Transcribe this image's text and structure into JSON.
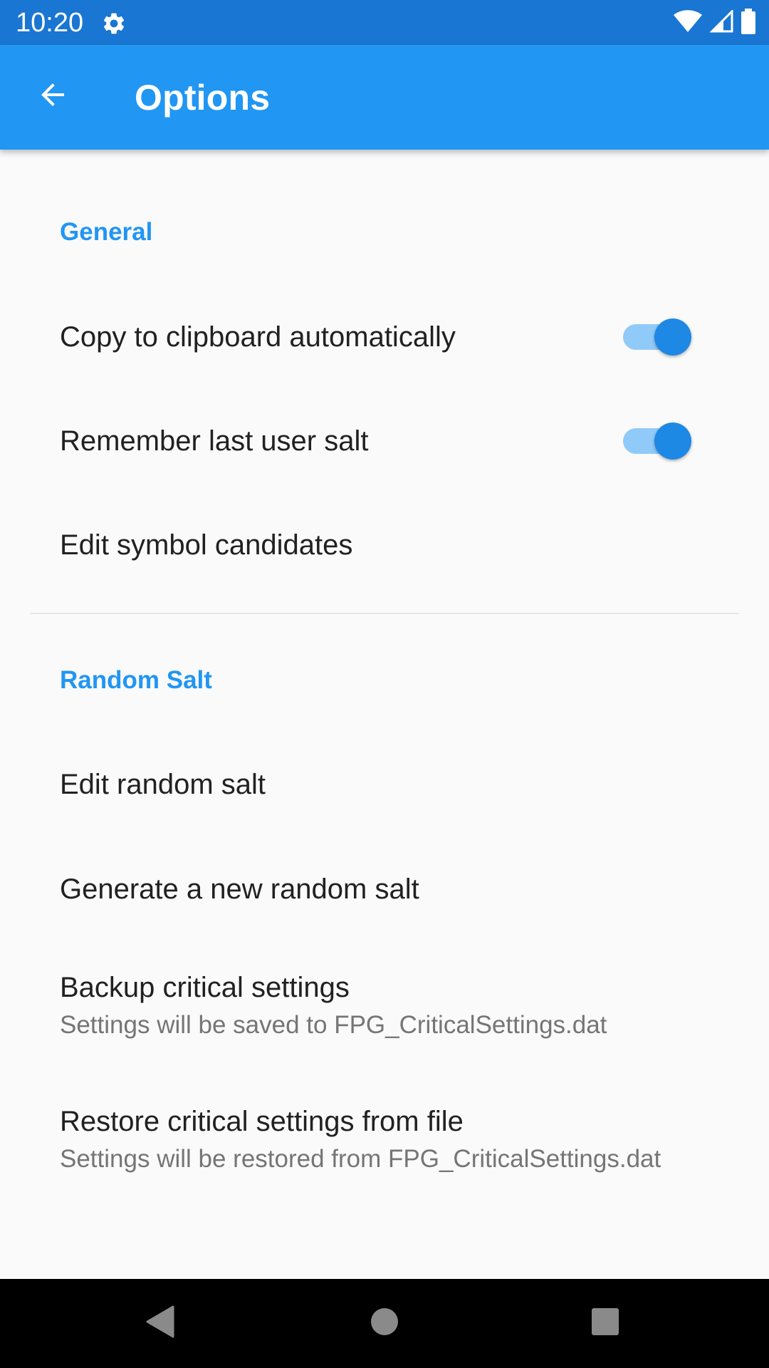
{
  "status_bar": {
    "time": "10:20",
    "icons": [
      "gear-icon",
      "wifi-icon",
      "signal-icon",
      "battery-icon"
    ]
  },
  "app_bar": {
    "title": "Options",
    "back_icon": "arrow-back-icon"
  },
  "sections": {
    "general": {
      "header": "General",
      "items": {
        "copy_clipboard": {
          "title": "Copy to clipboard automatically",
          "switch_on": true
        },
        "remember_salt": {
          "title": "Remember last user salt",
          "switch_on": true
        },
        "edit_symbols": {
          "title": "Edit symbol candidates"
        }
      }
    },
    "random_salt": {
      "header": "Random Salt",
      "items": {
        "edit_salt": {
          "title": "Edit random salt"
        },
        "generate_salt": {
          "title": "Generate a new random salt"
        },
        "backup": {
          "title": "Backup critical settings",
          "subtitle": "Settings will be saved to FPG_CriticalSettings.dat"
        },
        "restore": {
          "title": "Restore critical settings from file",
          "subtitle": "Settings will be restored from FPG_CriticalSettings.dat"
        }
      }
    }
  },
  "nav_bar": {
    "icons": [
      "back-triangle-icon",
      "home-circle-icon",
      "recents-square-icon"
    ]
  },
  "colors": {
    "status_bar": "#1976d2",
    "app_bar": "#2196f3",
    "accent": "#2196f3",
    "switch_thumb": "#1e88e5",
    "switch_track": "#90caf9",
    "background": "#fafafa"
  }
}
